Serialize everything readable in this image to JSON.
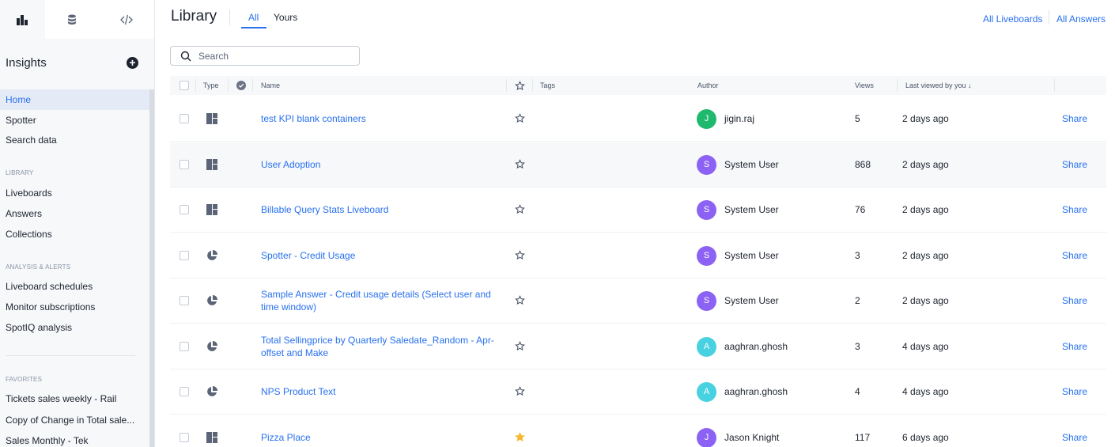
{
  "sidebar": {
    "title": "Insights",
    "items_top": [
      "Home",
      "Spotter",
      "Search data"
    ],
    "section_library": "LIBRARY",
    "items_library": [
      "Liveboards",
      "Answers",
      "Collections"
    ],
    "section_analysis": "ANALYSIS & ALERTS",
    "items_analysis": [
      "Liveboard schedules",
      "Monitor subscriptions",
      "SpotIQ analysis"
    ],
    "section_favorites": "FAVORITES",
    "items_favorites": [
      "Tickets sales weekly - Rail",
      "Copy of Change in Total sale...",
      "Sales Monthly - Tek"
    ]
  },
  "header": {
    "title": "Library",
    "tabs": [
      "All",
      "Yours"
    ],
    "links": [
      "All Liveboards",
      "All Answers"
    ]
  },
  "search": {
    "placeholder": "Search"
  },
  "table": {
    "columns": {
      "type": "Type",
      "name": "Name",
      "tags": "Tags",
      "author": "Author",
      "views": "Views",
      "last_viewed": "Last viewed by you ↓"
    },
    "rows": [
      {
        "type": "liveboard",
        "name": "test KPI blank containers",
        "starred": false,
        "avatar": "J",
        "avatar_color": "#1fb96e",
        "author": "jigin.raj",
        "views": "5",
        "last_viewed": "2 days ago",
        "action": "Share"
      },
      {
        "type": "liveboard",
        "name": "User Adoption",
        "starred": false,
        "avatar": "S",
        "avatar_color": "#8c62f5",
        "author": "System User",
        "views": "868",
        "last_viewed": "2 days ago",
        "action": "Share"
      },
      {
        "type": "liveboard",
        "name": "Billable Query Stats Liveboard",
        "starred": false,
        "avatar": "S",
        "avatar_color": "#8c62f5",
        "author": "System User",
        "views": "76",
        "last_viewed": "2 days ago",
        "action": "Share"
      },
      {
        "type": "answer",
        "name": "Spotter - Credit Usage",
        "starred": false,
        "avatar": "S",
        "avatar_color": "#8c62f5",
        "author": "System User",
        "views": "3",
        "last_viewed": "2 days ago",
        "action": "Share"
      },
      {
        "type": "answer",
        "name": "Sample Answer - Credit usage details (Select user and time window)",
        "starred": false,
        "avatar": "S",
        "avatar_color": "#8c62f5",
        "author": "System User",
        "views": "2",
        "last_viewed": "2 days ago",
        "action": "Share"
      },
      {
        "type": "answer",
        "name": "Total Sellingprice by Quarterly Saledate_Random - Apr-offset and Make",
        "starred": false,
        "avatar": "A",
        "avatar_color": "#48d1e0",
        "author": "aaghran.ghosh",
        "views": "3",
        "last_viewed": "4 days ago",
        "action": "Share"
      },
      {
        "type": "answer",
        "name": "NPS Product Text",
        "starred": false,
        "avatar": "A",
        "avatar_color": "#48d1e0",
        "author": "aaghran.ghosh",
        "views": "4",
        "last_viewed": "4 days ago",
        "action": "Share"
      },
      {
        "type": "liveboard",
        "name": "Pizza Place",
        "starred": true,
        "avatar": "J",
        "avatar_color": "#8c62f5",
        "author": "Jason Knight",
        "views": "117",
        "last_viewed": "6 days ago",
        "action": "Share"
      }
    ]
  }
}
